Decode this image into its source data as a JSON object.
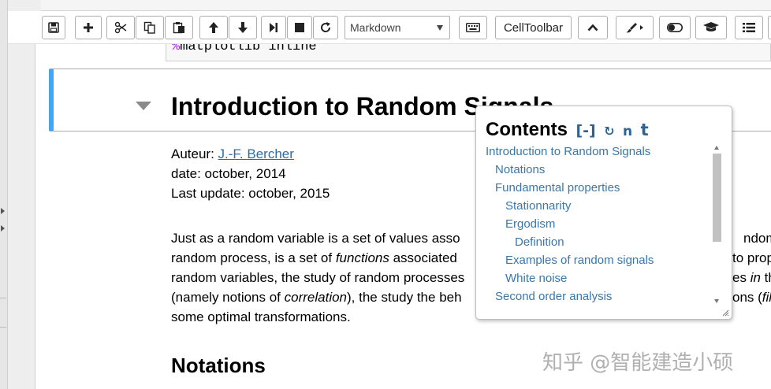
{
  "toolbar": {
    "cell_type_select": "Markdown",
    "celltoolbar_label": "CellToolbar"
  },
  "notebook": {
    "code_magic": "%",
    "code_text": "matplotlib inline",
    "heading": "Introduction to Random Signals",
    "author_label": "Auteur: ",
    "author_link": "J.-F. Bercher",
    "date_line": "date: october, 2014",
    "update_line": "Last update: october, 2015",
    "para_lines": [
      [
        "Just as a random variable is a set of values asso",
        "",
        "ndom s"
      ],
      [
        "random process, is a set of ",
        "functions",
        " associated",
        " to prop"
      ],
      [
        "random variables, the study of random processes",
        "es ",
        "in",
        " th"
      ],
      [
        "(namely notions of ",
        "correlation",
        "), the study the beh",
        "ons (",
        "fil"
      ],
      [
        "some optimal transformations."
      ]
    ],
    "subheading": "Notations"
  },
  "toc": {
    "title": "Contents",
    "collapse": "[-]",
    "refresh": "↻",
    "number": "n",
    "toggle": "t",
    "items": [
      {
        "label": "Introduction to Random Signals",
        "level": 1
      },
      {
        "label": "Notations",
        "level": 2
      },
      {
        "label": "Fundamental properties",
        "level": 2
      },
      {
        "label": "Stationnarity",
        "level": 3
      },
      {
        "label": "Ergodism",
        "level": 3
      },
      {
        "label": "Definition",
        "level": 4
      },
      {
        "label": "Examples of random signals",
        "level": 3
      },
      {
        "label": "White noise",
        "level": 3
      },
      {
        "label": "Second order analysis",
        "level": 2
      }
    ]
  },
  "watermark": "知乎 @智能建造小硕",
  "colors": {
    "selected_cell_border": "#42a5f5",
    "link": "#296eaa",
    "toc_link": "#3a77ab",
    "code_magic": "#aa22ff"
  }
}
